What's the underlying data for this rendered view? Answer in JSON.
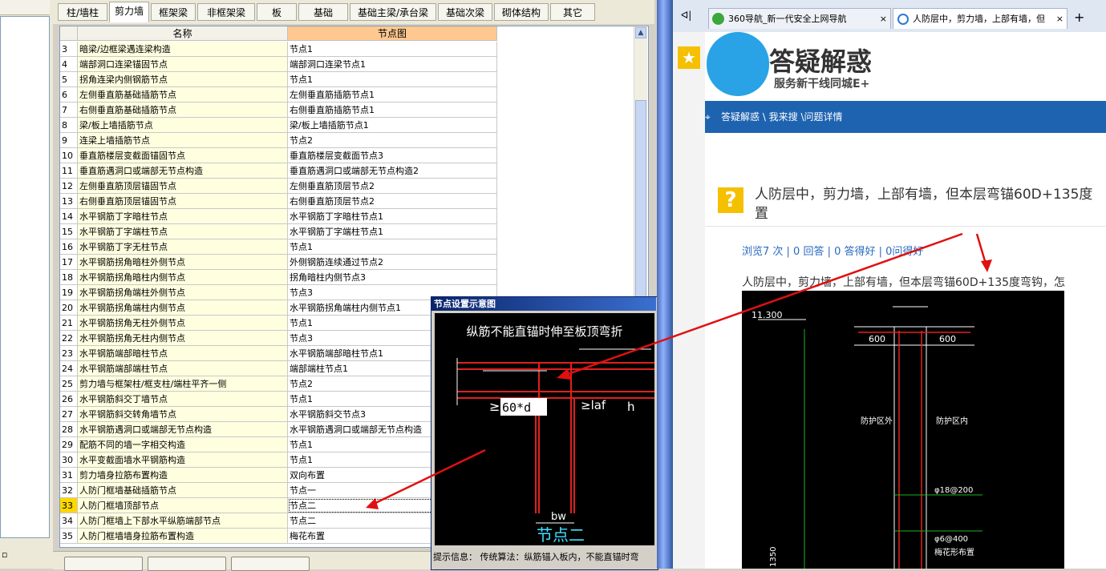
{
  "tabs": [
    "柱/墙柱",
    "剪力墙",
    "框架梁",
    "非框架梁",
    "板",
    "基础",
    "基础主梁/承台梁",
    "基础次梁",
    "砌体结构",
    "其它"
  ],
  "active_tab": "剪力墙",
  "grid": {
    "headers": {
      "name": "名称",
      "node": "节点图"
    },
    "rows": [
      {
        "n": "3",
        "name": "暗梁/边框梁遇连梁构造",
        "node": "节点1"
      },
      {
        "n": "4",
        "name": "端部洞口连梁锚固节点",
        "node": "端部洞口连梁节点1"
      },
      {
        "n": "5",
        "name": "拐角连梁内侧钢筋节点",
        "node": "节点1"
      },
      {
        "n": "6",
        "name": "左侧垂直筋基础插筋节点",
        "node": "左侧垂直筋插筋节点1"
      },
      {
        "n": "7",
        "name": "右侧垂直筋基础插筋节点",
        "node": "右侧垂直筋插筋节点1"
      },
      {
        "n": "8",
        "name": "梁/板上墙插筋节点",
        "node": "梁/板上墙插筋节点1"
      },
      {
        "n": "9",
        "name": "连梁上墙插筋节点",
        "node": "节点2"
      },
      {
        "n": "10",
        "name": "垂直筋楼层变截面锚固节点",
        "node": "垂直筋楼层变截面节点3"
      },
      {
        "n": "11",
        "name": "垂直筋遇洞口或端部无节点构造",
        "node": "垂直筋遇洞口或端部无节点构造2"
      },
      {
        "n": "12",
        "name": "左侧垂直筋顶层锚固节点",
        "node": "左侧垂直筋顶层节点2"
      },
      {
        "n": "13",
        "name": "右侧垂直筋顶层锚固节点",
        "node": "右侧垂直筋顶层节点2"
      },
      {
        "n": "14",
        "name": "水平钢筋丁字暗柱节点",
        "node": "水平钢筋丁字暗柱节点1"
      },
      {
        "n": "15",
        "name": "水平钢筋丁字端柱节点",
        "node": "水平钢筋丁字端柱节点1"
      },
      {
        "n": "16",
        "name": "水平钢筋丁字无柱节点",
        "node": "节点1"
      },
      {
        "n": "17",
        "name": "水平钢筋拐角暗柱外侧节点",
        "node": "外侧钢筋连续通过节点2"
      },
      {
        "n": "18",
        "name": "水平钢筋拐角暗柱内侧节点",
        "node": "拐角暗柱内侧节点3"
      },
      {
        "n": "19",
        "name": "水平钢筋拐角端柱外侧节点",
        "node": "节点3"
      },
      {
        "n": "20",
        "name": "水平钢筋拐角端柱内侧节点",
        "node": "水平钢筋拐角端柱内侧节点1"
      },
      {
        "n": "21",
        "name": "水平钢筋拐角无柱外侧节点",
        "node": "节点1"
      },
      {
        "n": "22",
        "name": "水平钢筋拐角无柱内侧节点",
        "node": "节点3"
      },
      {
        "n": "23",
        "name": "水平钢筋端部暗柱节点",
        "node": "水平钢筋端部暗柱节点1"
      },
      {
        "n": "24",
        "name": "水平钢筋端部端柱节点",
        "node": "端部端柱节点1"
      },
      {
        "n": "25",
        "name": "剪力墙与框架柱/框支柱/端柱平齐一侧",
        "node": "节点2"
      },
      {
        "n": "26",
        "name": "水平钢筋斜交丁墙节点",
        "node": "节点1"
      },
      {
        "n": "27",
        "name": "水平钢筋斜交转角墙节点",
        "node": "水平钢筋斜交节点3"
      },
      {
        "n": "28",
        "name": "水平钢筋遇洞口或端部无节点构造",
        "node": "水平钢筋遇洞口或端部无节点构造"
      },
      {
        "n": "29",
        "name": "配筋不同的墙一字相交构造",
        "node": "节点1"
      },
      {
        "n": "30",
        "name": "水平变截面墙水平钢筋构造",
        "node": "节点1"
      },
      {
        "n": "31",
        "name": "剪力墙身拉筋布置构造",
        "node": "双向布置"
      },
      {
        "n": "32",
        "name": "人防门框墙基础插筋节点",
        "node": "节点一"
      },
      {
        "n": "33",
        "name": "人防门框墙顶部节点",
        "node": "节点二"
      },
      {
        "n": "34",
        "name": "人防门框墙上下部水平纵筋端部节点",
        "node": "节点二"
      },
      {
        "n": "35",
        "name": "人防门框墙墙身拉筋布置构造",
        "node": "梅花布置"
      }
    ]
  },
  "popup": {
    "title": "节点设置示意图",
    "caption": "纵筋不能直锚时伸至板顶弯折",
    "input_value": "60*d",
    "ge": "≥",
    "laf_label": "≥laf",
    "h_label": "h",
    "bw_label": "bw",
    "node_name": "节点二",
    "hint": "提示信息：  传统算法：纵筋锚入板内，不能直锚时弯"
  },
  "browser": {
    "tabs": [
      {
        "title": "360导航_新一代安全上网导航",
        "close": "×"
      },
      {
        "title": "人防层中，剪力墙，上部有墙，但",
        "close": "×"
      }
    ],
    "back_icon": "ᐊ|",
    "new_tab": "+",
    "logo_text": "答疑解惑",
    "logo_sub": "服务新干线同城E+",
    "breadcrumb": "答疑解惑 \\ 我来搜 \\问题详情",
    "question_mark": "?",
    "question_title_line1": "人防层中，剪力墙，上部有墙，但本层弯锚60D+135度",
    "question_title_line2": "置",
    "stats": "浏览7 次 | 0 回答 | 0 答得好 | 0问得好",
    "question_body": "人防层中，剪力墙，上部有墙，但本层弯锚60D+135度弯钩，怎",
    "cad": {
      "elev": "11.300",
      "dim1": "600",
      "dim2": "600",
      "zone1": "防护区外",
      "zone2": "防护区内",
      "rebar1": "φ18@200",
      "rebar2": "φ6@400",
      "rebar3": "梅花形布置",
      "side": "1350"
    }
  },
  "colors": {
    "accent": "#1e63b0",
    "arrow": "#e01010",
    "name_bg": "#ffffe0",
    "node_header_bg": "#ffc890"
  }
}
